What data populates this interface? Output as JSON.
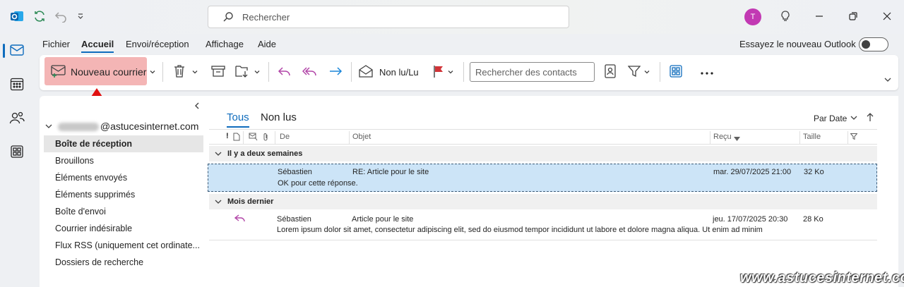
{
  "search": {
    "placeholder": "Rechercher"
  },
  "avatar_initial": "T",
  "menu": {
    "tabs": [
      "Fichier",
      "Accueil",
      "Envoi/réception",
      "Affichage",
      "Aide"
    ],
    "active": "Accueil"
  },
  "try_new": {
    "label": "Essayez le nouveau Outlook",
    "enabled": false
  },
  "ribbon": {
    "new_mail_label": "Nouveau courrier",
    "unread_label": "Non lu/Lu",
    "contact_search_placeholder": "Rechercher des contacts"
  },
  "account": {
    "email_visible": "@astucesinternet.com"
  },
  "folders": [
    {
      "label": "Boîte de réception",
      "selected": true
    },
    {
      "label": "Brouillons"
    },
    {
      "label": "Éléments envoyés"
    },
    {
      "label": "Éléments supprimés"
    },
    {
      "label": "Boîte d'envoi"
    },
    {
      "label": "Courrier indésirable"
    },
    {
      "label": "Flux RSS (uniquement cet ordinate..."
    },
    {
      "label": "Dossiers de recherche"
    }
  ],
  "list": {
    "filter_tabs": [
      "Tous",
      "Non lus"
    ],
    "sort_label": "Par Date",
    "columns": {
      "from": "De",
      "subject": "Objet",
      "received": "Reçu",
      "size": "Taille"
    },
    "groups": [
      {
        "label": "Il y a deux semaines",
        "messages": [
          {
            "from": "Sébastien",
            "subject": "RE: Article pour le site",
            "received": "mar. 29/07/2025 21:00",
            "size": "32 Ko",
            "preview": "OK pour cette réponse.",
            "selected": true,
            "replied": false
          }
        ]
      },
      {
        "label": "Mois dernier",
        "messages": [
          {
            "from": "Sébastien",
            "subject": "Article pour le site",
            "received": "jeu. 17/07/2025 20:30",
            "size": "28 Ko",
            "preview": "Lorem ipsum dolor sit amet, consectetur adipiscing elit, sed do eiusmod tempor incididunt ut labore et dolore magna aliqua. Ut enim ad minim",
            "selected": false,
            "replied": true
          }
        ]
      }
    ]
  },
  "watermark": "www.astucesinternet.com",
  "colors": {
    "accent": "#0f6cbd",
    "highlight": "#f4b5b5",
    "arrow": "#e01010",
    "avatar": "#c239b3",
    "selected_row": "#cce4f7"
  }
}
